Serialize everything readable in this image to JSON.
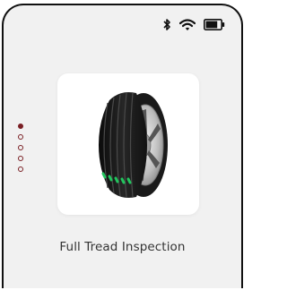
{
  "status_bar": {
    "icons": [
      "bluetooth-icon",
      "wifi-icon",
      "battery-icon"
    ],
    "battery_level": 0.8
  },
  "pager": {
    "total": 5,
    "active_index": 0
  },
  "card": {
    "image": "tire-icon",
    "caption": "Full Tread Inspection"
  },
  "colors": {
    "background": "#f1f1f1",
    "accent": "#7a1f24",
    "tread_highlight": "#22c55e"
  }
}
